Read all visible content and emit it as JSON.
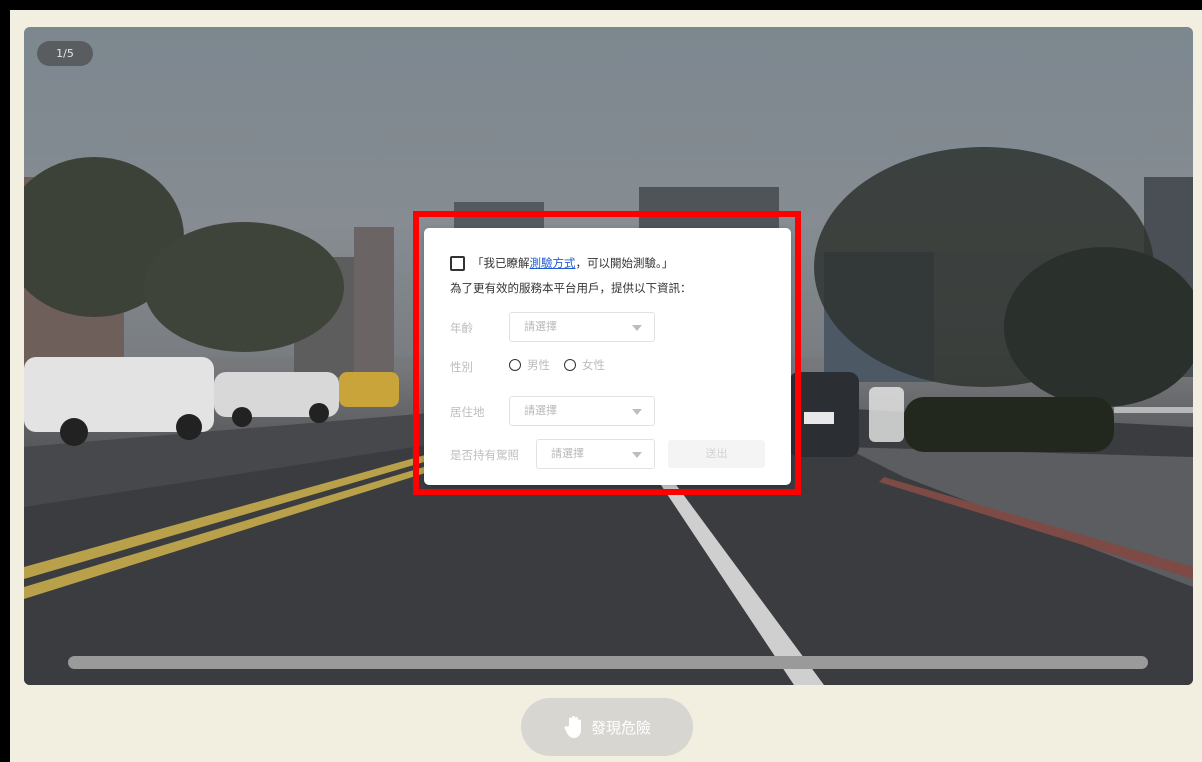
{
  "player": {
    "counter": "1/5",
    "progress": 0.0
  },
  "dialog": {
    "agree_prefix": "「我已瞭解",
    "agree_link": "測驗方式",
    "agree_suffix": "，可以開始測驗。」",
    "intro": "為了更有效的服務本平台用戶，提供以下資訊：",
    "age": {
      "label": "年齡",
      "select_value": "請選擇"
    },
    "gender": {
      "label": "性別",
      "options": [
        "男性",
        "女性"
      ]
    },
    "residence": {
      "label": "居住地",
      "select_value": "請選擇"
    },
    "license": {
      "label": "是否持有駕照",
      "select_value": "請選擇"
    },
    "submit_label": "送出"
  },
  "actions": {
    "danger_label": "發現危險",
    "danger_icon": "hand-icon"
  },
  "colors": {
    "highlight": "#ff0000",
    "link": "#1e5cd6",
    "page_bg": "#f2eee0"
  }
}
